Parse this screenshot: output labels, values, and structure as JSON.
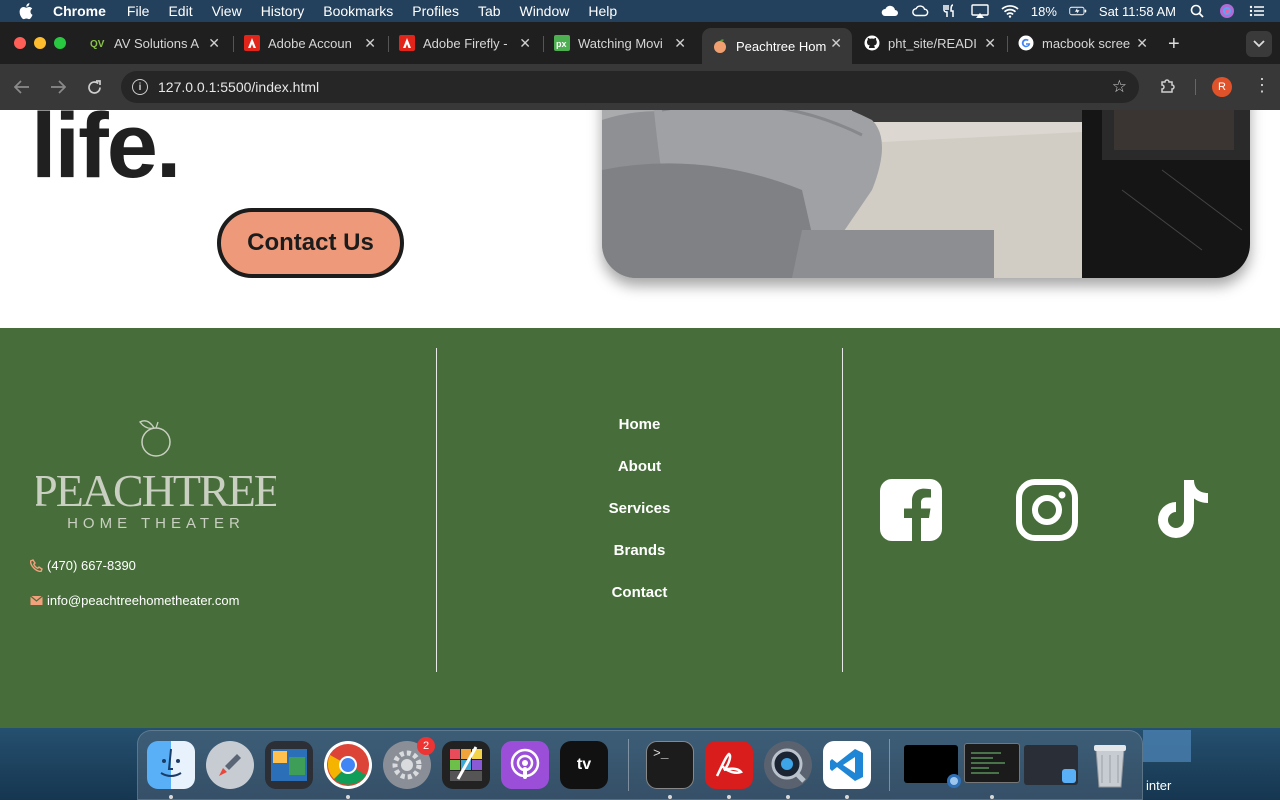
{
  "menubar": {
    "app": "Chrome",
    "items": [
      "File",
      "Edit",
      "View",
      "History",
      "Bookmarks",
      "Profiles",
      "Tab",
      "Window",
      "Help"
    ],
    "battery": "18%",
    "clock": "Sat 11:58 AM"
  },
  "tabs": [
    {
      "title": "AV Solutions A",
      "icon": "qv-icon"
    },
    {
      "title": "Adobe Accoun",
      "icon": "adobe-icon"
    },
    {
      "title": "Adobe Firefly -",
      "icon": "adobe-icon"
    },
    {
      "title": "Watching Movi",
      "icon": "px-icon"
    },
    {
      "title": "Peachtree Hom",
      "icon": "peach-icon"
    },
    {
      "title": "pht_site/READI",
      "icon": "github-icon"
    },
    {
      "title": "macbook scree",
      "icon": "google-icon"
    }
  ],
  "toolbar": {
    "url": "127.0.0.1:5500/index.html",
    "profile_initial": "R"
  },
  "hero": {
    "word": "life.",
    "cta": "Contact Us"
  },
  "footer": {
    "logo_line1": "PEACHTREE",
    "logo_line2": "HOME THEATER",
    "phone": "(470) 667-8390",
    "email": "info@peachtreehometheater.com",
    "nav": [
      "Home",
      "About",
      "Services",
      "Brands",
      "Contact"
    ],
    "social": [
      "facebook-icon",
      "instagram-icon",
      "tiktok-icon"
    ]
  },
  "dock": {
    "settings_badge": "2",
    "desktop_label": "inter"
  },
  "colors": {
    "footer_bg": "#476e3a",
    "cta_bg": "#ee9a7a",
    "heading": "#202020"
  }
}
